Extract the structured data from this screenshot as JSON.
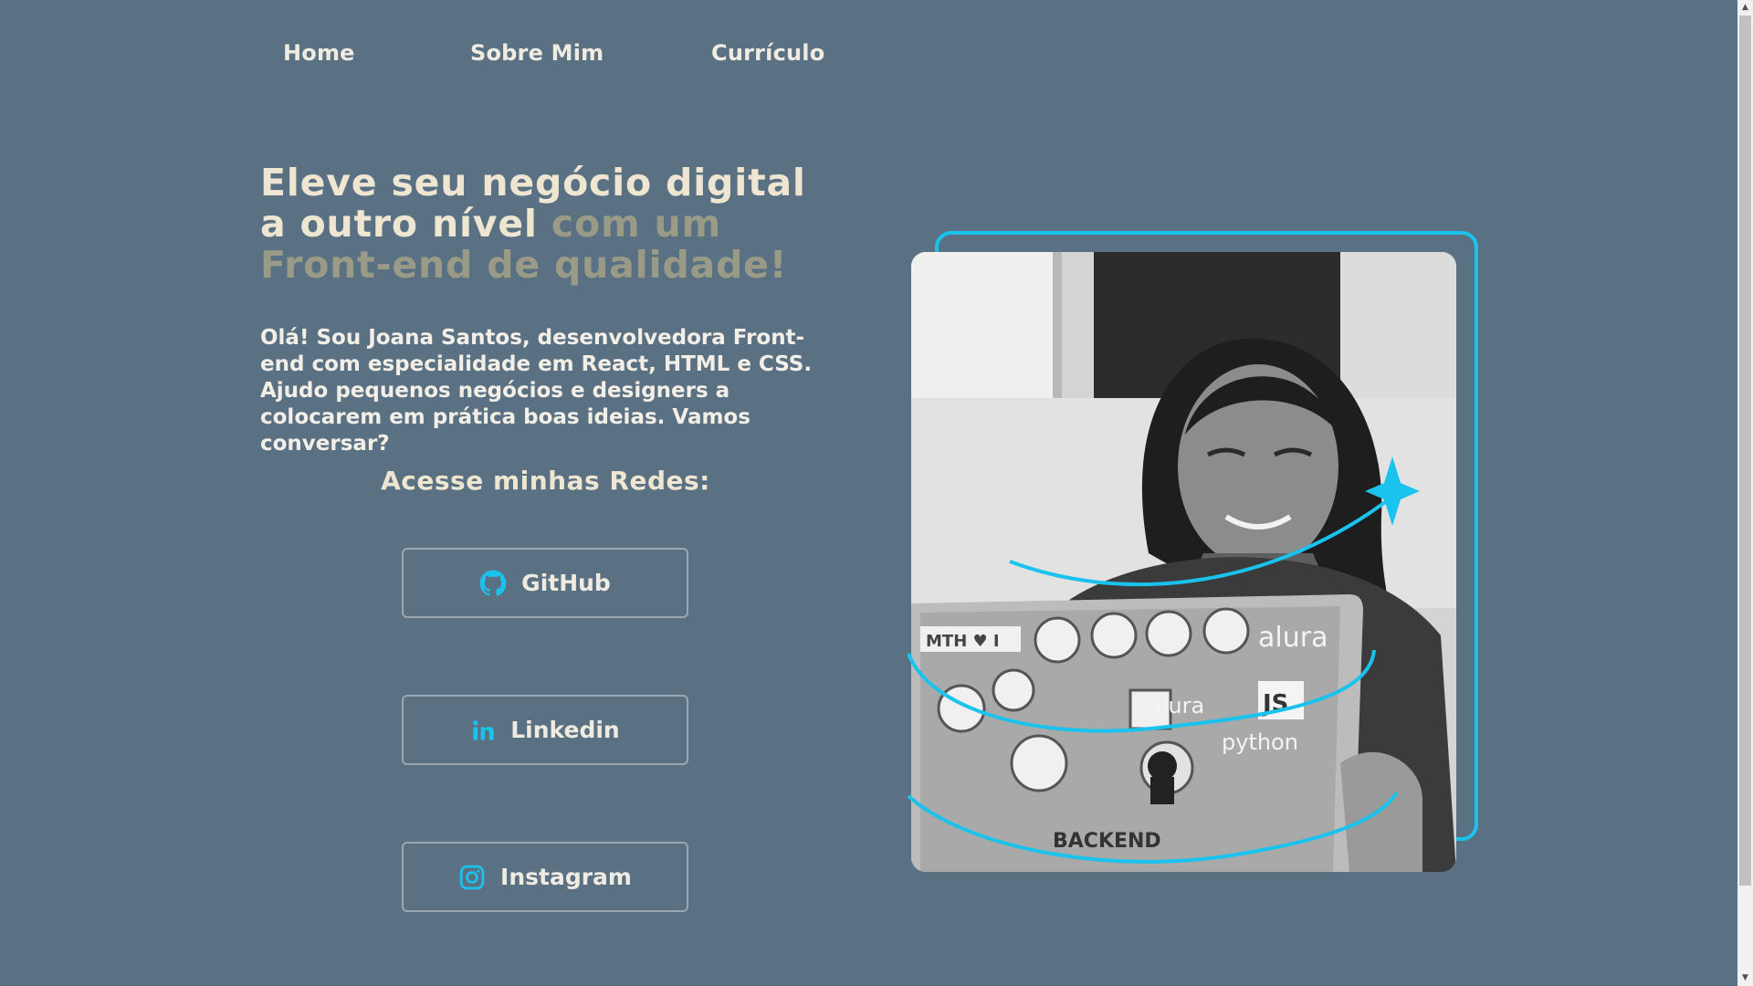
{
  "nav": {
    "items": [
      {
        "label": "Home"
      },
      {
        "label": "Sobre Mim"
      },
      {
        "label": "Currículo"
      }
    ]
  },
  "hero": {
    "title_line1": "Eleve seu negócio digital",
    "title_line2_main": "a outro nível ",
    "title_line2_muted": "com um",
    "title_line3_muted": "Front-end de qualidade!",
    "intro": "Olá! Sou Joana Santos, desenvolvedora Front-end com especialidade em React, HTML e CSS. Ajudo pequenos negócios e designers a colocarem em prática boas ideias. Vamos conversar?"
  },
  "social": {
    "heading": "Acesse minhas Redes:",
    "buttons": [
      {
        "label": "GitHub",
        "icon": "github-icon"
      },
      {
        "label": "Linkedin",
        "icon": "linkedin-icon"
      },
      {
        "label": "Instagram",
        "icon": "instagram-icon"
      }
    ]
  },
  "colors": {
    "background": "#5a7184",
    "accent": "#1ac2ee",
    "title_text": "#efe6d2",
    "title_muted": "#9a9b86"
  },
  "photo": {
    "sticker_texts": [
      "alura",
      "JS",
      "python",
      "alura",
      "BACKEND",
      "MTH ♥ I"
    ]
  }
}
